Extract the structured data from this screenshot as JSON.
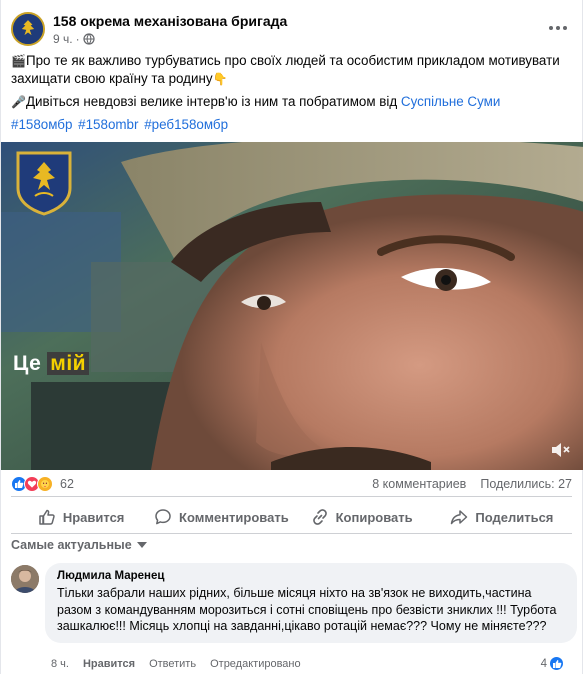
{
  "post": {
    "page_name": "158 окрема механізована бригада",
    "time": "9 ч.",
    "separator": "·",
    "text_line1": "Про те як важливо турбуватись про своїх людей та особистим прикладом мотивувати захищати свою країну та родину",
    "text_line2_prefix": "Дивіться невдовзі велике інтерв'ю із ним та побратимом від ",
    "text_line2_link": "Суспільне Суми",
    "hashtags": [
      "#158омбр",
      "#158ombr",
      "#реб158омбр"
    ],
    "emoji_clapper": "🎬",
    "emoji_point": "👇",
    "emoji_mic": "🎤"
  },
  "media": {
    "caption_white": "Це",
    "caption_highlight": "мій"
  },
  "stats": {
    "reactions_count": "62",
    "comments": "8 комментариев",
    "shares": "Поделились: 27"
  },
  "actions": {
    "like": "Нравится",
    "comment": "Комментировать",
    "copy": "Копировать",
    "share": "Поделиться"
  },
  "sort": {
    "label": "Самые актуальные"
  },
  "comment": {
    "author": "Людмила Маренец",
    "text": "Тільки забрали наших рідних, більше місяця ніхто на зв'язок не виходить,частина разом з командуванням морозиться і сотні сповіщень про безвісти зниклих !!! Турбота зашкалює!!! Місяць хлопці на завданні,цікаво ротацій немає??? Чому не міняєте???",
    "time": "8 ч.",
    "like": "Нравится",
    "reply": "Ответить",
    "edited": "Отредактировано",
    "likes_count": "4"
  },
  "colors": {
    "link": "#216fdb",
    "muted": "#65676b",
    "like_blue": "#1877f2",
    "caption_yellow": "#f4d000"
  },
  "icons": {
    "globe": "globe-icon",
    "more": "more-options-icon",
    "mute": "mute-icon",
    "like": "thumbs-up-icon",
    "comment": "comment-bubble-icon",
    "copy": "link-icon",
    "share": "share-arrow-icon"
  }
}
